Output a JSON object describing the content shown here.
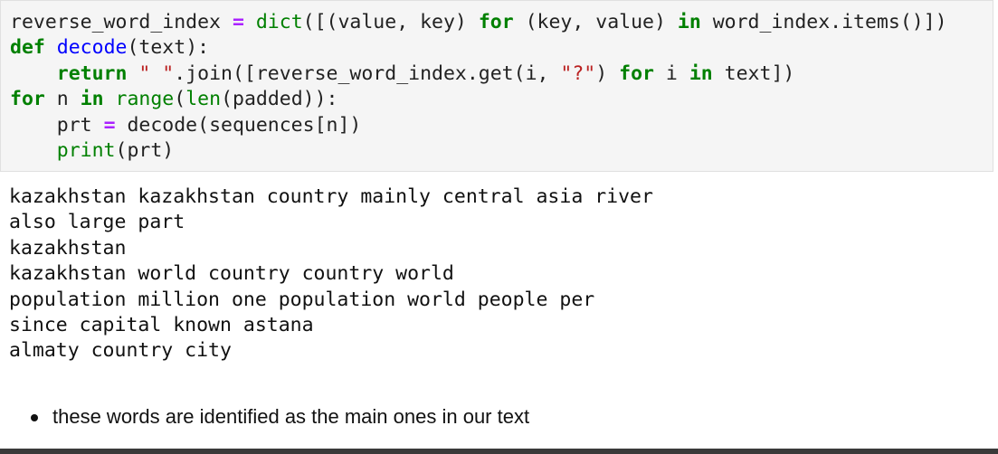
{
  "code_cell": {
    "lines": [
      [
        {
          "t": "reverse_word_index ",
          "c": "plain"
        },
        {
          "t": "=",
          "c": "op"
        },
        {
          "t": " ",
          "c": "plain"
        },
        {
          "t": "dict",
          "c": "bi"
        },
        {
          "t": "([(value, key) ",
          "c": "plain"
        },
        {
          "t": "for",
          "c": "kw"
        },
        {
          "t": " (key, value) ",
          "c": "plain"
        },
        {
          "t": "in",
          "c": "kw"
        },
        {
          "t": " word_index.items()])",
          "c": "plain"
        }
      ],
      [
        {
          "t": "def",
          "c": "kw"
        },
        {
          "t": " ",
          "c": "plain"
        },
        {
          "t": "decode",
          "c": "fn"
        },
        {
          "t": "(text):",
          "c": "plain"
        }
      ],
      [
        {
          "t": "    ",
          "c": "plain"
        },
        {
          "t": "return",
          "c": "kw"
        },
        {
          "t": " ",
          "c": "plain"
        },
        {
          "t": "\" \"",
          "c": "str"
        },
        {
          "t": ".join([reverse_word_index.get(i, ",
          "c": "plain"
        },
        {
          "t": "\"?\"",
          "c": "str"
        },
        {
          "t": ") ",
          "c": "plain"
        },
        {
          "t": "for",
          "c": "kw"
        },
        {
          "t": " i ",
          "c": "plain"
        },
        {
          "t": "in",
          "c": "kw"
        },
        {
          "t": " text])",
          "c": "plain"
        }
      ],
      [
        {
          "t": "for",
          "c": "kw"
        },
        {
          "t": " n ",
          "c": "plain"
        },
        {
          "t": "in",
          "c": "kw"
        },
        {
          "t": " ",
          "c": "plain"
        },
        {
          "t": "range",
          "c": "bi"
        },
        {
          "t": "(",
          "c": "plain"
        },
        {
          "t": "len",
          "c": "bi"
        },
        {
          "t": "(padded)):",
          "c": "plain"
        }
      ],
      [
        {
          "t": "    prt ",
          "c": "plain"
        },
        {
          "t": "=",
          "c": "op"
        },
        {
          "t": " decode(sequences[n])",
          "c": "plain"
        }
      ],
      [
        {
          "t": "    ",
          "c": "plain"
        },
        {
          "t": "print",
          "c": "bi"
        },
        {
          "t": "(prt)",
          "c": "plain"
        }
      ]
    ]
  },
  "output": {
    "lines": [
      "kazakhstan kazakhstan country mainly central asia river",
      "also large part",
      "kazakhstan",
      "kazakhstan world country country world",
      "population million one population world people per",
      "since capital known astana",
      "almaty country city"
    ]
  },
  "markdown": {
    "bullets": [
      "these words are identified as the main ones in our text"
    ]
  }
}
